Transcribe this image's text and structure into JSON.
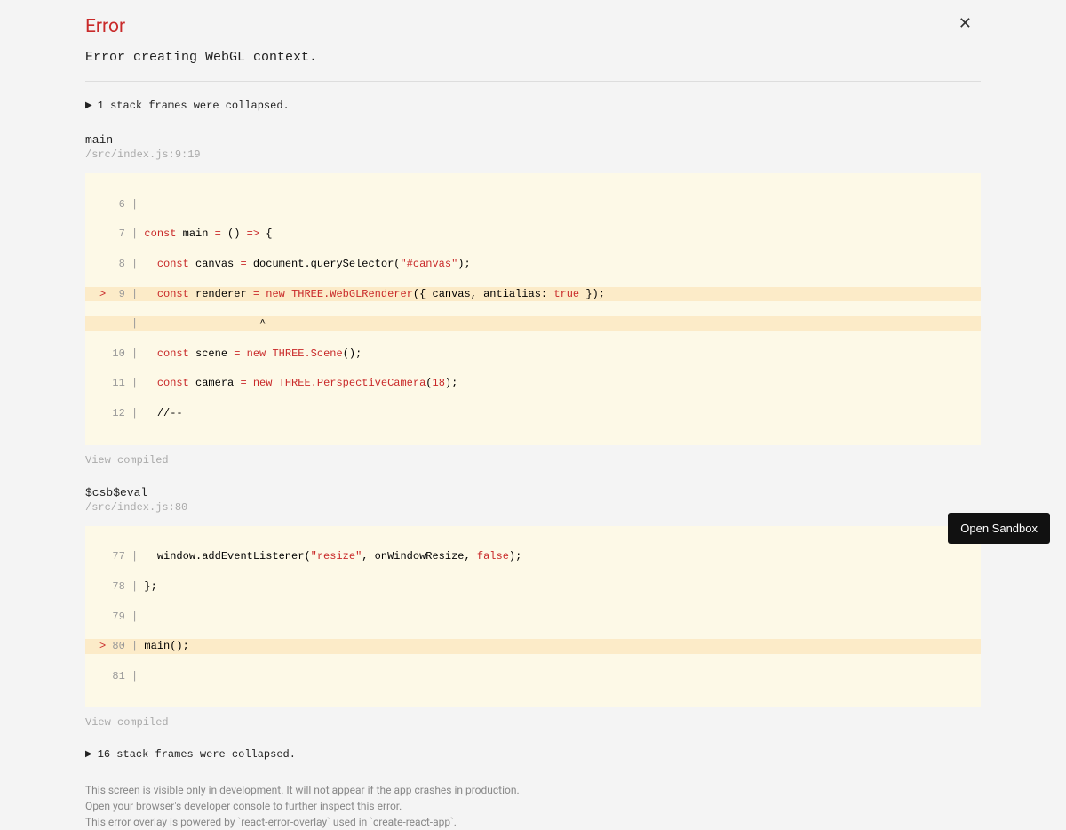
{
  "header": {
    "title": "Error",
    "message": "Error creating WebGL context."
  },
  "collapsed1": "1 stack frames were collapsed.",
  "frame1": {
    "name": "main",
    "location": "/src/index.js:9:19",
    "lines": {
      "l6": {
        "num": "   6 |"
      },
      "l7": {
        "num": "   7 |",
        "kw": " const",
        "rest": " main ",
        "op": "=",
        "rest2": " () ",
        "arrow": "=>",
        "brace": " {"
      },
      "l8": {
        "num": "   8 |",
        "kw": "   const",
        "rest": " canvas ",
        "op": "=",
        "rest2": " document.querySelector(",
        "str": "\"#canvas\"",
        "end": ");"
      },
      "l9": {
        "caret": ">",
        "num": "  9 |",
        "kw": "   const",
        "rest": " renderer ",
        "op": "=",
        "new": " new ",
        "cls": "THREE.WebGLRenderer",
        "paren": "({ canvas, antialias: ",
        "bool": "true",
        "end": " });"
      },
      "lp": {
        "num": "     |",
        "ptr": "                   ^"
      },
      "l10": {
        "num": "  10 |",
        "kw": "   const",
        "rest": " scene ",
        "op": "=",
        "new": " new ",
        "cls": "THREE.Scene",
        "end": "();"
      },
      "l11": {
        "num": "  11 |",
        "kw": "   const",
        "rest": " camera ",
        "op": "=",
        "new": " new ",
        "cls": "THREE.PerspectiveCamera",
        "paren": "(",
        "num2": "18",
        "end": ");"
      },
      "l12": {
        "num": "  12 |",
        "cmt": "   //--"
      }
    },
    "view": "View compiled"
  },
  "frame2": {
    "name": "$csb$eval",
    "location": "/src/index.js:80",
    "lines": {
      "l77": {
        "num": "  77 |",
        "rest": "   window.addEventListener(",
        "str": "\"resize\"",
        "rest2": ", onWindowResize, ",
        "bool": "false",
        "end": ");"
      },
      "l78": {
        "num": "  78 |",
        "rest": " };"
      },
      "l79": {
        "num": "  79 |"
      },
      "l80": {
        "caret": ">",
        "num": " 80 |",
        "rest": " main();"
      },
      "l81": {
        "num": "  81 |"
      }
    },
    "view": "View compiled"
  },
  "collapsed2": "16 stack frames were collapsed.",
  "footer": {
    "l1": "This screen is visible only in development. It will not appear if the app crashes in production.",
    "l2": "Open your browser's developer console to further inspect this error.",
    "l3": "This error overlay is powered by `react-error-overlay` used in `create-react-app`."
  },
  "sandbox": "Open Sandbox"
}
